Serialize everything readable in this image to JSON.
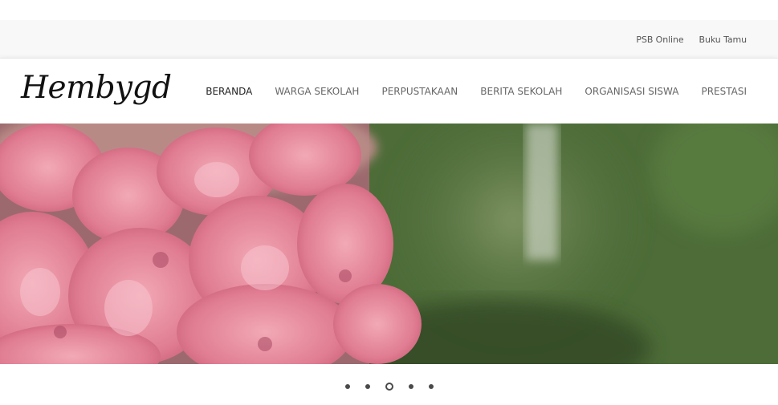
{
  "topbar": {
    "links": [
      "PSB Online",
      "Buku Tamu"
    ]
  },
  "header": {
    "logo_text": "Hembygd",
    "nav": [
      {
        "label": "BERANDA",
        "active": true
      },
      {
        "label": "WARGA SEKOLAH",
        "active": false
      },
      {
        "label": "PERPUSTAKAAN",
        "active": false
      },
      {
        "label": "BERITA SEKOLAH",
        "active": false
      },
      {
        "label": "ORGANISASI SISWA",
        "active": false
      },
      {
        "label": "PRESTASI",
        "active": false
      }
    ]
  },
  "slider": {
    "image": "pink-geranium-flowers-photo",
    "slide_count": 5,
    "active_slide": 3
  },
  "colors": {
    "topbar_bg": "#f8f8f8",
    "nav_text": "#666666",
    "nav_active": "#222222",
    "dot": "#4a4a4a"
  }
}
